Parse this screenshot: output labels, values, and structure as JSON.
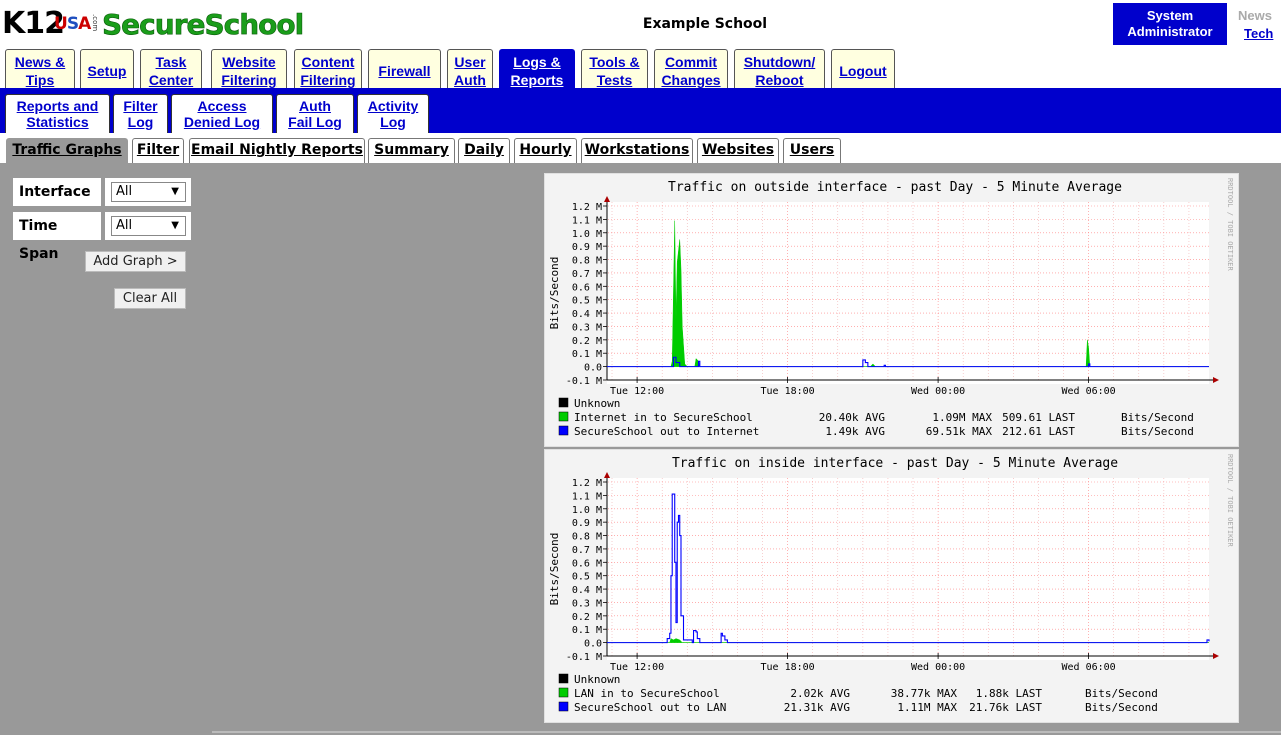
{
  "header": {
    "logo_k12": "K12",
    "logo_usa": "USA",
    "logo_com": ".com",
    "logo_product": "SecureSchool",
    "school_name": "Example School",
    "role_line1": "System",
    "role_line2": "Administrator",
    "news": "News",
    "tech": "Tech"
  },
  "main_tabs": [
    {
      "l1": "News &",
      "l2": "Tips"
    },
    {
      "l1": "Setup",
      "l2": ""
    },
    {
      "l1": "Task",
      "l2": "Center"
    },
    {
      "l1": "Website",
      "l2": "Filtering"
    },
    {
      "l1": "Content",
      "l2": "Filtering"
    },
    {
      "l1": "Firewall",
      "l2": ""
    },
    {
      "l1": "User",
      "l2": "Auth"
    },
    {
      "l1": "Logs &",
      "l2": "Reports"
    },
    {
      "l1": "Tools &",
      "l2": "Tests"
    },
    {
      "l1": "Commit",
      "l2": "Changes"
    },
    {
      "l1": "Shutdown/",
      "l2": "Reboot"
    },
    {
      "l1": "Logout",
      "l2": ""
    }
  ],
  "sub_tabs": [
    {
      "l1": "Reports and",
      "l2": "Statistics"
    },
    {
      "l1": "Filter",
      "l2": "Log"
    },
    {
      "l1": "Access",
      "l2": "Denied Log"
    },
    {
      "l1": "Auth",
      "l2": "Fail Log"
    },
    {
      "l1": "Activity",
      "l2": "Log"
    }
  ],
  "report_tabs": [
    "Traffic Graphs",
    "Filter",
    "Email Nightly Reports",
    "Summary",
    "Daily",
    "Hourly",
    "Workstations",
    "Websites",
    "Users"
  ],
  "form": {
    "interface_label": "Interface",
    "interface_value": "All",
    "timespan_label": "Time Span",
    "timespan_value": "All",
    "add_graph": "Add Graph >",
    "clear_all": "Clear All"
  },
  "colors": {
    "nav_blue": "#0000cc",
    "tab_bg": "#ffffe0",
    "page_gray": "#999999",
    "series_green": "#00cc00",
    "series_blue": "#0000ff"
  },
  "graphs": [
    {
      "title": "Traffic on outside interface - past Day - 5 Minute Average",
      "ylabel": "Bits/Second",
      "watermark": "RRDTOOL / TOBI OETIKER",
      "legend": [
        {
          "color": "#000000",
          "name": "Unknown",
          "avg": "",
          "max": "",
          "last": "",
          "unit": ""
        },
        {
          "color": "#00cc00",
          "name": "Internet in to SecureSchool",
          "avg": "20.40k AVG",
          "max": "1.09M MAX",
          "last": "509.61  LAST",
          "unit": "Bits/Second"
        },
        {
          "color": "#0000ff",
          "name": "SecureSchool out to Internet",
          "avg": "1.49k AVG",
          "max": "69.51k MAX",
          "last": "212.61  LAST",
          "unit": "Bits/Second"
        }
      ]
    },
    {
      "title": "Traffic on inside interface - past Day - 5 Minute Average",
      "ylabel": "Bits/Second",
      "watermark": "RRDTOOL / TOBI OETIKER",
      "legend": [
        {
          "color": "#000000",
          "name": "Unknown",
          "avg": "",
          "max": "",
          "last": "",
          "unit": ""
        },
        {
          "color": "#00cc00",
          "name": "LAN in to SecureSchool",
          "avg": "2.02k AVG",
          "max": "38.77k MAX",
          "last": "1.88k LAST",
          "unit": "Bits/Second"
        },
        {
          "color": "#0000ff",
          "name": "SecureSchool out to LAN",
          "avg": "21.31k AVG",
          "max": "1.11M MAX",
          "last": "21.76k LAST",
          "unit": "Bits/Second"
        }
      ]
    }
  ],
  "chart_data": [
    {
      "type": "area",
      "title": "Traffic on outside interface - past Day - 5 Minute Average",
      "ylabel": "Bits/Second",
      "xlabel": "",
      "ylim": [
        -0.1,
        1.2
      ],
      "y_unit": "M",
      "yticks": [
        "1.2 M",
        "1.1 M",
        "1.0 M",
        "0.9 M",
        "0.8 M",
        "0.7 M",
        "0.6 M",
        "0.5 M",
        "0.4 M",
        "0.3 M",
        "0.2 M",
        "0.1 M",
        "0.0",
        "-0.1 M"
      ],
      "xticks": [
        "Tue 12:00",
        "Tue 18:00",
        "Wed 00:00",
        "Wed 06:00"
      ],
      "x_start_hours": 10.8,
      "x_end_hours": 34.8,
      "grid": true,
      "series": [
        {
          "name": "Internet in to SecureSchool",
          "color": "#00cc00",
          "style": "area",
          "points": [
            [
              10.8,
              0
            ],
            [
              13.35,
              0
            ],
            [
              13.4,
              0.04
            ],
            [
              13.5,
              1.09
            ],
            [
              13.55,
              0.35
            ],
            [
              13.6,
              0.78
            ],
            [
              13.7,
              0.95
            ],
            [
              13.75,
              0.73
            ],
            [
              13.8,
              0.3
            ],
            [
              13.9,
              0.02
            ],
            [
              14.0,
              0
            ],
            [
              14.3,
              0
            ],
            [
              14.35,
              0.06
            ],
            [
              14.45,
              0.04
            ],
            [
              14.5,
              0
            ],
            [
              21.3,
              0
            ],
            [
              21.4,
              0.02
            ],
            [
              21.5,
              0
            ],
            [
              29.9,
              0
            ],
            [
              29.95,
              0.2
            ],
            [
              30.0,
              0.14
            ],
            [
              30.05,
              0
            ],
            [
              34.8,
              0
            ]
          ]
        },
        {
          "name": "SecureSchool out to Internet",
          "color": "#0000ff",
          "style": "line",
          "points": [
            [
              10.8,
              0
            ],
            [
              13.35,
              0
            ],
            [
              13.45,
              0.07
            ],
            [
              13.55,
              0.03
            ],
            [
              13.7,
              0
            ],
            [
              14.35,
              0
            ],
            [
              14.45,
              0.04
            ],
            [
              14.5,
              0
            ],
            [
              20.9,
              0
            ],
            [
              21.0,
              0.05
            ],
            [
              21.1,
              0.03
            ],
            [
              21.2,
              0
            ],
            [
              21.8,
              0
            ],
            [
              21.85,
              0.01
            ],
            [
              21.9,
              0
            ],
            [
              29.95,
              0
            ],
            [
              30.0,
              0.02
            ],
            [
              30.05,
              0
            ],
            [
              34.8,
              0
            ]
          ]
        }
      ]
    },
    {
      "type": "area",
      "title": "Traffic on inside interface - past Day - 5 Minute Average",
      "ylabel": "Bits/Second",
      "xlabel": "",
      "ylim": [
        -0.1,
        1.2
      ],
      "y_unit": "M",
      "yticks": [
        "1.2 M",
        "1.1 M",
        "1.0 M",
        "0.9 M",
        "0.8 M",
        "0.7 M",
        "0.6 M",
        "0.5 M",
        "0.4 M",
        "0.3 M",
        "0.2 M",
        "0.1 M",
        "0.0",
        "-0.1 M"
      ],
      "xticks": [
        "Tue 12:00",
        "Tue 18:00",
        "Wed 00:00",
        "Wed 06:00"
      ],
      "x_start_hours": 10.8,
      "x_end_hours": 34.8,
      "grid": true,
      "series": [
        {
          "name": "LAN in to SecureSchool",
          "color": "#00cc00",
          "style": "area",
          "points": [
            [
              10.8,
              0
            ],
            [
              13.3,
              0
            ],
            [
              13.35,
              0.03
            ],
            [
              13.45,
              0.02
            ],
            [
              13.55,
              0.03
            ],
            [
              13.7,
              0.02
            ],
            [
              13.8,
              0
            ],
            [
              34.8,
              0
            ]
          ]
        },
        {
          "name": "SecureSchool out to LAN",
          "color": "#0000ff",
          "style": "line",
          "points": [
            [
              10.8,
              0
            ],
            [
              13.1,
              0
            ],
            [
              13.2,
              0.03
            ],
            [
              13.3,
              0.07
            ],
            [
              13.35,
              0.5
            ],
            [
              13.4,
              1.11
            ],
            [
              13.45,
              1.11
            ],
            [
              13.5,
              0.6
            ],
            [
              13.55,
              0.15
            ],
            [
              13.6,
              0.9
            ],
            [
              13.65,
              0.95
            ],
            [
              13.7,
              0.8
            ],
            [
              13.75,
              0.2
            ],
            [
              13.85,
              0.02
            ],
            [
              14.2,
              0
            ],
            [
              14.25,
              0.09
            ],
            [
              14.35,
              0.08
            ],
            [
              14.4,
              0.03
            ],
            [
              14.5,
              0
            ],
            [
              15.3,
              0
            ],
            [
              15.35,
              0.07
            ],
            [
              15.4,
              0.05
            ],
            [
              15.5,
              0.02
            ],
            [
              15.6,
              0
            ],
            [
              34.7,
              0
            ],
            [
              34.72,
              0.02
            ],
            [
              34.8,
              0.01
            ]
          ]
        }
      ]
    }
  ]
}
